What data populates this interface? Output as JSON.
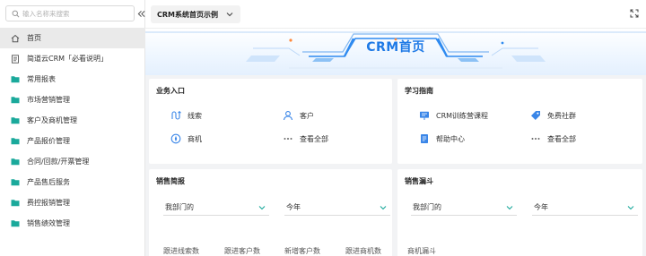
{
  "sidebar": {
    "search_placeholder": "输入名称来搜索",
    "items": [
      {
        "label": "首页",
        "icon": "home-icon",
        "active": true
      },
      {
        "label": "简道云CRM「必看说明」",
        "icon": "document-icon"
      },
      {
        "label": "常用报表",
        "icon": "folder-icon"
      },
      {
        "label": "市场营销管理",
        "icon": "folder-icon"
      },
      {
        "label": "客户及商机管理",
        "icon": "folder-icon"
      },
      {
        "label": "产品报价管理",
        "icon": "folder-icon"
      },
      {
        "label": "合同/回款/开票管理",
        "icon": "folder-icon"
      },
      {
        "label": "产品售后服务",
        "icon": "folder-icon"
      },
      {
        "label": "费控报销管理",
        "icon": "folder-icon"
      },
      {
        "label": "销售绩效管理",
        "icon": "folder-icon"
      }
    ]
  },
  "topbar": {
    "page_title": "CRM系统首页示例"
  },
  "banner": {
    "title": "CRM首页"
  },
  "business_entry": {
    "title": "业务入口",
    "items": [
      "线索",
      "客户",
      "商机",
      "查看全部"
    ]
  },
  "learning_guide": {
    "title": "学习指南",
    "items": [
      "CRM训练营课程",
      "免费社群",
      "帮助中心",
      "查看全部"
    ]
  },
  "sales_brief": {
    "title": "销售简报",
    "filter_dept": "我部门的",
    "filter_period": "今年",
    "metrics": [
      "跟进线索数",
      "跟进客户数",
      "新增客户数",
      "跟进商机数"
    ]
  },
  "sales_funnel": {
    "title": "销售漏斗",
    "filter_dept": "我部门的",
    "filter_period": "今年",
    "metric": "商机漏斗"
  },
  "colors": {
    "brand_blue": "#1f7ae6",
    "folder_teal": "#1aa99b",
    "icon_blue": "#3a86e8"
  }
}
